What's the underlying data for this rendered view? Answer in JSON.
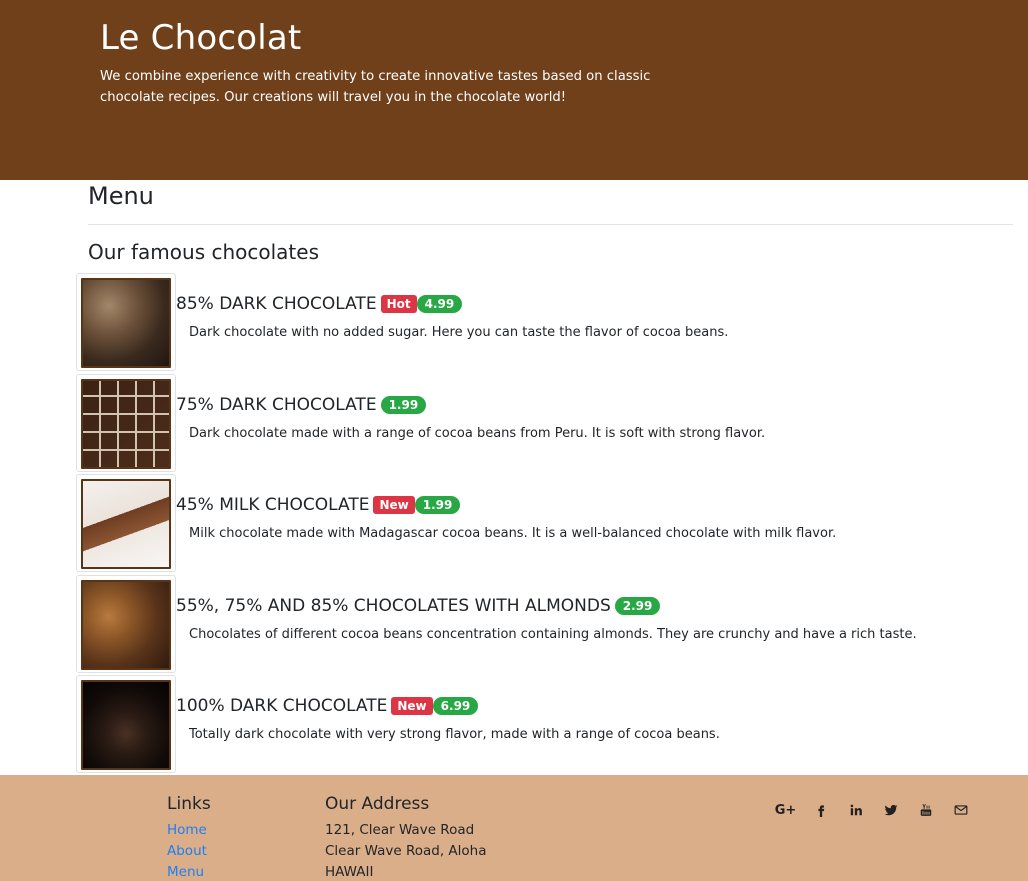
{
  "header": {
    "brand": "Le Chocolat",
    "tagline": "We combine experience with creativity to create innovative tastes based on classic chocolate recipes. Our creations will travel you in the chocolate world!"
  },
  "menu": {
    "title": "Menu",
    "subtitle": "Our famous chocolates",
    "items": [
      {
        "name": "85% DARK CHOCOLATE",
        "label": "Hot",
        "price": "4.99",
        "description": "Dark chocolate with no added sugar. Here you can taste the flavor of cocoa beans."
      },
      {
        "name": "75% DARK CHOCOLATE",
        "label": "",
        "price": "1.99",
        "description": "Dark chocolate made with a range of cocoa beans from Peru. It is soft with strong flavor."
      },
      {
        "name": "45% MILK CHOCOLATE",
        "label": "New",
        "price": "1.99",
        "description": "Milk chocolate made with Madagascar cocoa beans. It is a well-balanced chocolate with milk flavor."
      },
      {
        "name": "55%, 75% AND 85% CHOCOLATES WITH ALMONDS",
        "label": "",
        "price": "2.99",
        "description": "Chocolates of different cocoa beans concentration containing almonds. They are crunchy and have a rich taste."
      },
      {
        "name": "100% DARK CHOCOLATE",
        "label": "New",
        "price": "6.99",
        "description": "Totally dark chocolate with very strong flavor, made with a range of cocoa beans."
      }
    ]
  },
  "footer": {
    "links_title": "Links",
    "links": [
      "Home",
      "About",
      "Menu"
    ],
    "address_title": "Our Address",
    "address_lines": [
      "121, Clear Wave Road",
      "Clear Wave Road, Aloha",
      "HAWAII"
    ],
    "social": {
      "google_plus": "G+",
      "icons": [
        "facebook-icon",
        "linkedin-icon",
        "twitter-icon",
        "youtube-icon",
        "mail-icon"
      ]
    }
  },
  "colors": {
    "header_bg": "#6f4019",
    "footer_bg": "#dbae8a",
    "badge_hot": "#dc3545",
    "badge_price": "#28a745",
    "link": "#1e7ef3"
  }
}
